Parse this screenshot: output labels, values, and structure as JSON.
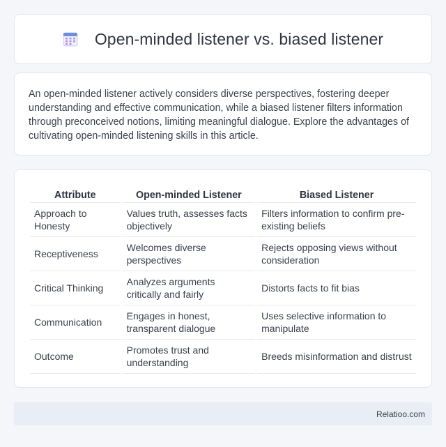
{
  "header": {
    "icon": "calendar-icon",
    "title": "Open-minded listener vs. biased listener"
  },
  "intro": {
    "text": "An open-minded listener actively considers diverse perspectives, fostering deeper understanding and effective communication, while a biased listener filters information through preconceived notions, limiting meaningful dialogue. Explore the advantages of cultivating open-minded listening skills in this article."
  },
  "table": {
    "headers": [
      "Attribute",
      "Open-minded Listener",
      "Biased Listener"
    ],
    "rows": [
      [
        "Approach to Honesty",
        "Values truth, assesses facts objectively",
        "Filters information to confirm pre-existing beliefs"
      ],
      [
        "Receptiveness",
        "Welcomes diverse perspectives",
        "Rejects opposing views without consideration"
      ],
      [
        "Critical Thinking",
        "Analyzes arguments critically and fairly",
        "Distorts facts to fit bias"
      ],
      [
        "Communication",
        "Engages in honest, transparent dialogue",
        "Uses selective information to manipulate"
      ],
      [
        "Outcome",
        "Promotes trust and understanding",
        "Breeds misinformation and distrust"
      ]
    ]
  },
  "footer": {
    "brand": "Relatioo.com"
  }
}
